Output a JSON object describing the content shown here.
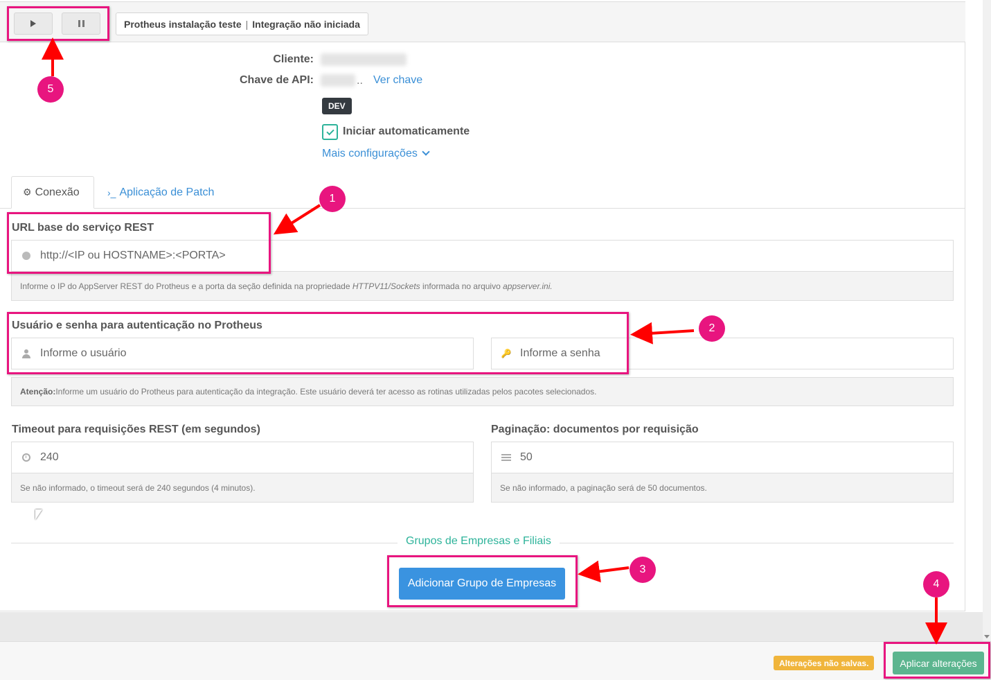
{
  "toolbar": {
    "play_icon": "play-icon",
    "pause_icon": "pause-icon",
    "installation_name": "Protheus instalação teste",
    "separator": "|",
    "integration_status": "Integração não iniciada"
  },
  "info": {
    "client_label": "Cliente:",
    "api_key_label": "Chave de API:",
    "api_key_ellipsis": "..",
    "view_key_link": "Ver chave",
    "env_badge": "DEV",
    "auto_start_label": "Iniciar automaticamente",
    "auto_start_checked": true,
    "more_settings_link": "Mais configurações"
  },
  "tabs": [
    {
      "label": "Conexão",
      "icon": "⚙",
      "active": true
    },
    {
      "label": "Aplicação de Patch",
      "icon": "›_",
      "active": false
    }
  ],
  "rest_url": {
    "label": "URL base do serviço REST",
    "placeholder": "http://<IP ou HOSTNAME>:<PORTA>",
    "help_prefix": "Informe o IP do AppServer REST do Protheus e a porta da seção definida na propriedade ",
    "help_prop": "HTTPV11/Sockets",
    "help_mid": " informada no arquivo ",
    "help_file": "appserver.ini."
  },
  "auth": {
    "label": "Usuário e senha para autenticação no Protheus",
    "user_placeholder": "Informe o usuário",
    "password_placeholder": "Informe a senha",
    "help_bold": "Atenção:",
    "help_text": " Informe um usuário do Protheus para autenticação da integração. Este usuário deverá ter acesso as rotinas utilizadas pelos pacotes selecionados."
  },
  "timeout": {
    "label": "Timeout para requisições REST (em segundos)",
    "value": "240",
    "help": "Se não informado, o timeout será de 240 segundos (4 minutos)."
  },
  "pagination": {
    "label": "Paginação: documentos por requisição",
    "value": "50",
    "help": "Se não informado, a paginação será de 50 documentos."
  },
  "groups": {
    "section_title": "Grupos de Empresas e Filiais",
    "add_button": "Adicionar Grupo de Empresas"
  },
  "footer": {
    "unsaved_badge": "Alterações não salvas.",
    "apply_button": "Aplicar alterações"
  },
  "annotations": {
    "markers": [
      "1",
      "2",
      "3",
      "4",
      "5"
    ],
    "color": "#e8157f",
    "arrow_color": "#ff0000"
  }
}
